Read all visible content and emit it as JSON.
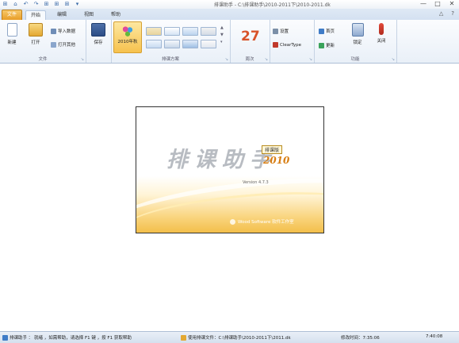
{
  "titlebar": {
    "quick_access": [
      "⊞",
      "⌂",
      "↶",
      "↷",
      "⊞",
      "⊞",
      "⊞",
      "▾"
    ],
    "title": "排课助手 - C:\\排课助手\\2010-2011下\\2010-2011.dk",
    "controls": {
      "minimize": "—",
      "maximize": "□",
      "close": "✕"
    }
  },
  "tabs": {
    "file": "文件",
    "items": [
      "开始",
      "编辑",
      "视图",
      "帮助"
    ],
    "active_index": 0,
    "right_icons": [
      "△",
      "?"
    ]
  },
  "ribbon": {
    "file_group": {
      "label": "文件",
      "new": "新建",
      "open": "打开",
      "small": [
        "导入数据",
        "打开其他"
      ]
    },
    "save_group": {
      "save": "保存"
    },
    "scheme_group": {
      "label": "排课方案",
      "current": "2010年秋",
      "theme_count": 8
    },
    "week_group": {
      "label": "周次",
      "week": "27"
    },
    "misc_group": {
      "small": [
        "设置",
        "ClearType"
      ]
    },
    "tools_group": {
      "label": "功能",
      "small": [
        "首页",
        "更新"
      ],
      "lock": "锁定",
      "close": "关闭"
    }
  },
  "splash": {
    "brand": "排课助手",
    "edition": "排课版",
    "year": "2010",
    "version": "Version 4.7.3",
    "company": "Wood Software 软件工作室"
  },
  "statusbar": {
    "left": "排课助手 ： 就绪 ，如需帮助，请选择 F1 键 ，按 F1 获取帮助",
    "file": "使用排课文件：C:\\排课助手\\2010-2011下\\2011.dk",
    "time_label": "修改时间：7:35:06",
    "clock": "7:40:08"
  },
  "colors": {
    "accent": "#e89d28",
    "ribbon_bg": "#e9f0f8",
    "week_number": "#d8532a"
  }
}
